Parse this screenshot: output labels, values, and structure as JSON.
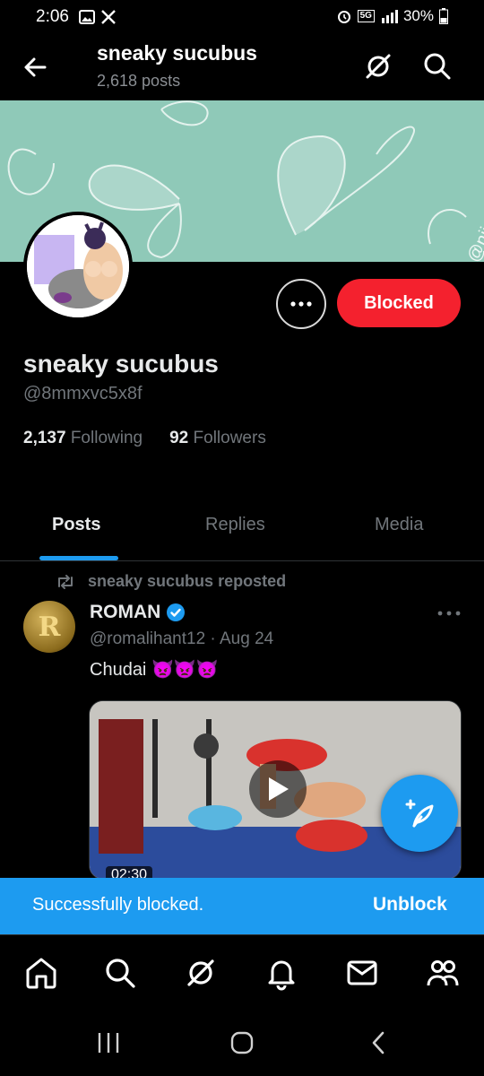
{
  "status_bar": {
    "time": "2:06",
    "left_icons": [
      "gallery-icon",
      "x-logo-icon"
    ],
    "network": "5G",
    "battery": "30%"
  },
  "header": {
    "title": "sneaky sucubus",
    "post_count": "2,618 posts",
    "icons": [
      "back-arrow-icon",
      "grok-icon",
      "search-icon"
    ]
  },
  "banner": {
    "watermark": "@nij",
    "color": "#8fc9b8"
  },
  "profile": {
    "display_name": "sneaky sucubus",
    "handle": "@8mmxvc5x8f",
    "following_count": "2,137",
    "following_label": "Following",
    "followers_count": "92",
    "followers_label": "Followers",
    "blocked_label": "Blocked",
    "blocked_color": "#f4212e"
  },
  "tabs": [
    {
      "label": "Posts",
      "active": true
    },
    {
      "label": "Replies",
      "active": false
    },
    {
      "label": "Media",
      "active": false
    }
  ],
  "post": {
    "repost_text": "sneaky sucubus reposted",
    "author": "ROMAN",
    "verified": true,
    "handle": "@romalihant12",
    "separator": "·",
    "date": "Aug 24",
    "text": "Chudai",
    "emojis": "👿👿👿",
    "video_duration": "02:30"
  },
  "snackbar": {
    "message": "Successfully blocked.",
    "action": "Unblock",
    "color": "#1d9bf0"
  },
  "bottom_nav": {
    "items": [
      "home-icon",
      "search-icon",
      "grok-icon",
      "notifications-icon",
      "messages-icon",
      "communities-icon"
    ]
  },
  "accent": "#1d9bf0"
}
